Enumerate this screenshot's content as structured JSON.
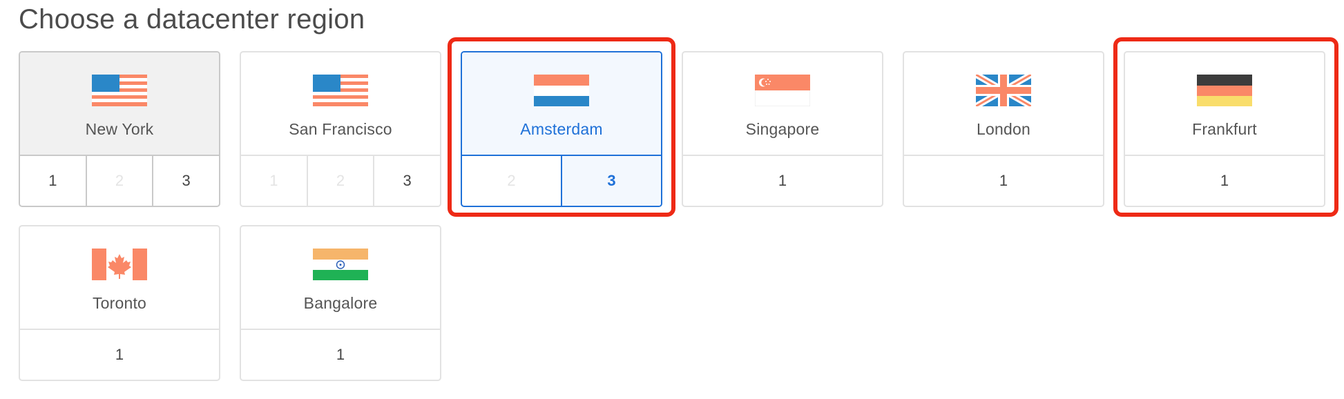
{
  "page": {
    "title": "Choose a datacenter region"
  },
  "colors": {
    "accent": "#1f71d8",
    "highlight": "#ee2a16",
    "flag_blue": "#2a87c8",
    "flag_orange": "#fa8867",
    "flag_dark": "#3c3c3c",
    "flag_yellow": "#f9dd6b"
  },
  "regions": [
    {
      "name": "New York",
      "flag": "us-flag-icon",
      "datacenters": [
        "1",
        "2",
        "3"
      ],
      "disabled": [
        "2"
      ],
      "selected": "1"
    },
    {
      "name": "San Francisco",
      "flag": "us-flag-icon",
      "datacenters": [
        "1",
        "2",
        "3"
      ],
      "disabled": [
        "1",
        "2"
      ]
    },
    {
      "name": "Amsterdam",
      "flag": "netherlands-flag-icon",
      "datacenters": [
        "2",
        "3"
      ],
      "disabled": [
        "2"
      ],
      "selected": "3"
    },
    {
      "name": "Singapore",
      "flag": "singapore-flag-icon",
      "datacenters": [
        "1"
      ]
    },
    {
      "name": "London",
      "flag": "uk-flag-icon",
      "datacenters": [
        "1"
      ]
    },
    {
      "name": "Frankfurt",
      "flag": "germany-flag-icon",
      "datacenters": [
        "1"
      ]
    },
    {
      "name": "Toronto",
      "flag": "canada-flag-icon",
      "datacenters": [
        "1"
      ]
    },
    {
      "name": "Bangalore",
      "flag": "india-flag-icon",
      "datacenters": [
        "1"
      ]
    }
  ],
  "highlighted_regions": [
    "Amsterdam",
    "Frankfurt"
  ]
}
